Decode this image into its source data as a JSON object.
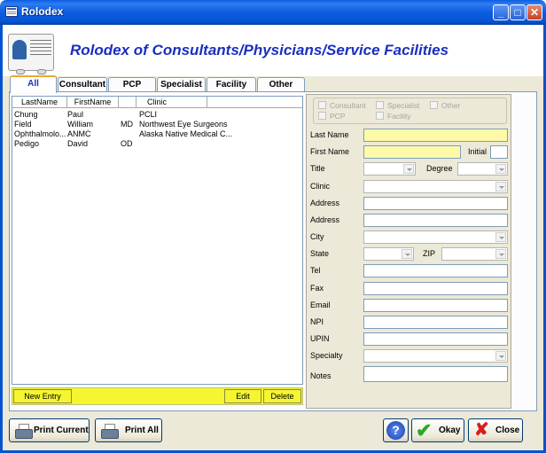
{
  "window": {
    "title": "Rolodex"
  },
  "header": {
    "title": "Rolodex of Consultants/Physicians/Service Facilities"
  },
  "tabs": [
    {
      "label": "All",
      "active": true
    },
    {
      "label": "Consultant",
      "active": false
    },
    {
      "label": "PCP",
      "active": false
    },
    {
      "label": "Specialist",
      "active": false
    },
    {
      "label": "Facility",
      "active": false
    },
    {
      "label": "Other",
      "active": false
    }
  ],
  "list": {
    "columns": [
      "LastName",
      "FirstName",
      "",
      "Clinic"
    ],
    "rows": [
      {
        "last": "Chung",
        "first": "Paul",
        "degree": "",
        "clinic": "PCLI"
      },
      {
        "last": "Field",
        "first": "William",
        "degree": "MD",
        "clinic": "Northwest Eye Surgeons"
      },
      {
        "last": "Ophthalmolo...",
        "first": "ANMC",
        "degree": "",
        "clinic": "Alaska Native Medical C..."
      },
      {
        "last": "Pedigo",
        "first": "David",
        "degree": "OD",
        "clinic": ""
      }
    ]
  },
  "list_actions": {
    "new_entry": "New Entry",
    "edit": "Edit",
    "delete": "Delete"
  },
  "types": {
    "consultant": "Consultant",
    "specialist": "Specialist",
    "other": "Other",
    "pcp": "PCP",
    "facility": "Facility"
  },
  "form": {
    "last_name": "Last Name",
    "first_name": "First Name",
    "initial": "Initial",
    "title": "Title",
    "degree": "Degree",
    "clinic": "Clinic",
    "address1": "Address",
    "address2": "Address",
    "city": "City",
    "state": "State",
    "zip": "ZIP",
    "tel": "Tel",
    "fax": "Fax",
    "email": "Email",
    "npi": "NPI",
    "upin": "UPIN",
    "specialty": "Specialty",
    "notes": "Notes"
  },
  "buttons": {
    "print_current": "Print Current",
    "print_all": "Print All",
    "help": "?",
    "okay": "Okay",
    "close": "Close"
  },
  "colors": {
    "accent": "#1a2fbf",
    "highlight_yellow": "#f5f530",
    "field_yellow": "#fffaa8",
    "window_blue": "#0553d0"
  }
}
